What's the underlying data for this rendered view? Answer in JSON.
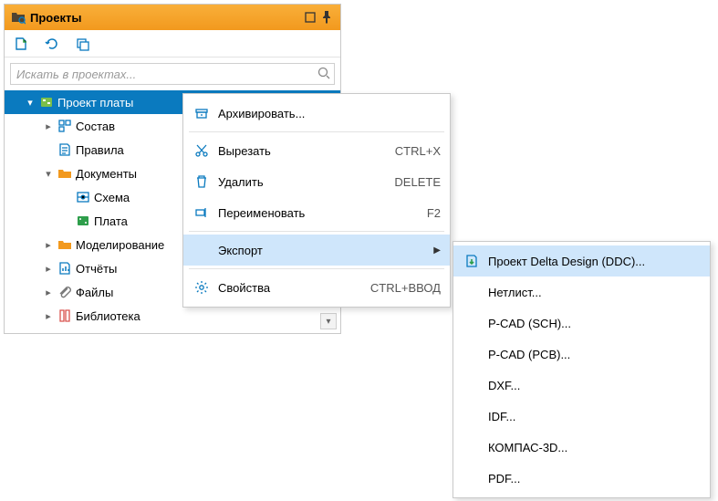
{
  "panel": {
    "title": "Проекты",
    "search_placeholder": "Искать в проектах..."
  },
  "tree": {
    "root": "Проект платы",
    "items": [
      {
        "label": "Состав"
      },
      {
        "label": "Правила"
      },
      {
        "label": "Документы"
      },
      {
        "label": "Схема"
      },
      {
        "label": "Плата"
      },
      {
        "label": "Моделирование"
      },
      {
        "label": "Отчёты"
      },
      {
        "label": "Файлы"
      },
      {
        "label": "Библиотека"
      }
    ]
  },
  "menu": {
    "archive": {
      "label": "Архивировать...",
      "hotkey": ""
    },
    "cut": {
      "label": "Вырезать",
      "hotkey": "CTRL+X"
    },
    "delete": {
      "label": "Удалить",
      "hotkey": "DELETE"
    },
    "rename": {
      "label": "Переименовать",
      "hotkey": "F2"
    },
    "export": {
      "label": "Экспорт",
      "hotkey": ""
    },
    "props": {
      "label": "Свойства",
      "hotkey": "CTRL+ВВОД"
    }
  },
  "submenu": {
    "items": [
      "Проект Delta Design (DDC)...",
      "Нетлист...",
      "P-CAD (SCH)...",
      "P-CAD (PCB)...",
      "DXF...",
      "IDF...",
      "КОМПАС-3D...",
      "PDF..."
    ]
  }
}
